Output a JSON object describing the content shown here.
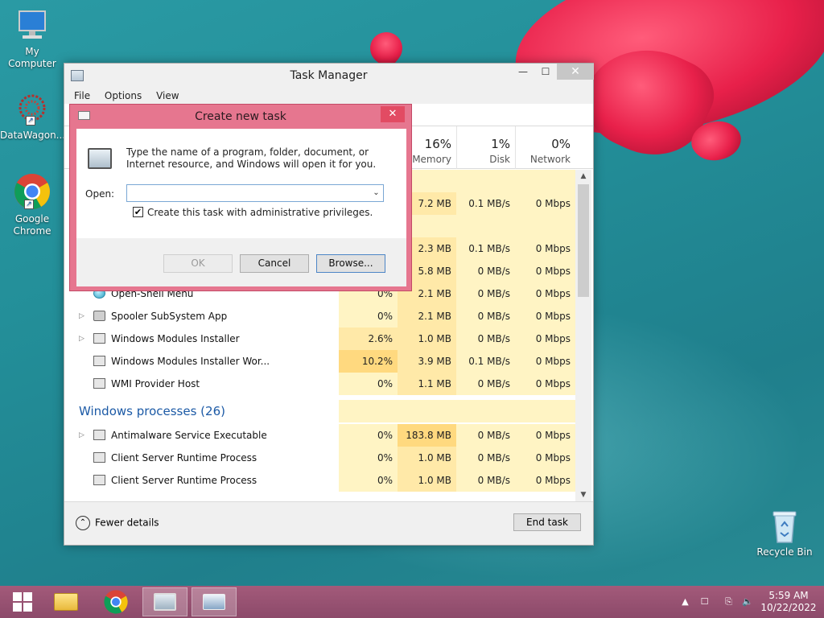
{
  "desktop": {
    "icons": [
      {
        "label": "My Computer"
      },
      {
        "label": "DataWagon..."
      },
      {
        "label": "Google Chrome"
      },
      {
        "label": "Recycle Bin"
      }
    ]
  },
  "task_manager": {
    "title": "Task Manager",
    "menu": [
      "File",
      "Options",
      "View"
    ],
    "columns": [
      {
        "pct": "16%",
        "label": "Memory"
      },
      {
        "pct": "1%",
        "label": "Disk"
      },
      {
        "pct": "0%",
        "label": "Network"
      }
    ],
    "partial_rows": [
      {
        "mem": "7.2 MB",
        "disk": "0.1 MB/s",
        "net": "0 Mbps"
      },
      {
        "mem": "2.3 MB",
        "disk": "0.1 MB/s",
        "net": "0 Mbps"
      },
      {
        "mem": "5.8 MB",
        "disk": "0 MB/s",
        "net": "0 Mbps"
      }
    ],
    "rows": [
      {
        "name": "Open-Shell Menu",
        "cpu": "0%",
        "mem": "2.1 MB",
        "disk": "0 MB/s",
        "net": "0 Mbps"
      },
      {
        "name": "Spooler SubSystem App",
        "cpu": "0%",
        "mem": "2.1 MB",
        "disk": "0 MB/s",
        "net": "0 Mbps"
      },
      {
        "name": "Windows Modules Installer",
        "cpu": "2.6%",
        "mem": "1.0 MB",
        "disk": "0 MB/s",
        "net": "0 Mbps"
      },
      {
        "name": "Windows Modules Installer Wor...",
        "cpu": "10.2%",
        "mem": "3.9 MB",
        "disk": "0.1 MB/s",
        "net": "0 Mbps"
      },
      {
        "name": "WMI Provider Host",
        "cpu": "0%",
        "mem": "1.1 MB",
        "disk": "0 MB/s",
        "net": "0 Mbps"
      }
    ],
    "group_header": "Windows processes (26)",
    "win_rows": [
      {
        "name": "Antimalware Service Executable",
        "cpu": "0%",
        "mem": "183.8 MB",
        "disk": "0 MB/s",
        "net": "0 Mbps"
      },
      {
        "name": "Client Server Runtime Process",
        "cpu": "0%",
        "mem": "1.0 MB",
        "disk": "0 MB/s",
        "net": "0 Mbps"
      },
      {
        "name": "Client Server Runtime Process",
        "cpu": "0%",
        "mem": "1.0 MB",
        "disk": "0 MB/s",
        "net": "0 Mbps"
      }
    ],
    "fewer_details": "Fewer details",
    "end_task": "End task"
  },
  "dialog": {
    "title": "Create new task",
    "description": "Type the name of a program, folder, document, or Internet resource, and Windows will open it for you.",
    "open_label": "Open:",
    "open_value": "",
    "checkbox_label": "Create this task with administrative privileges.",
    "checkbox_checked": true,
    "ok": "OK",
    "cancel": "Cancel",
    "browse": "Browse..."
  },
  "taskbar": {
    "time": "5:59 AM",
    "date": "10/22/2022"
  }
}
